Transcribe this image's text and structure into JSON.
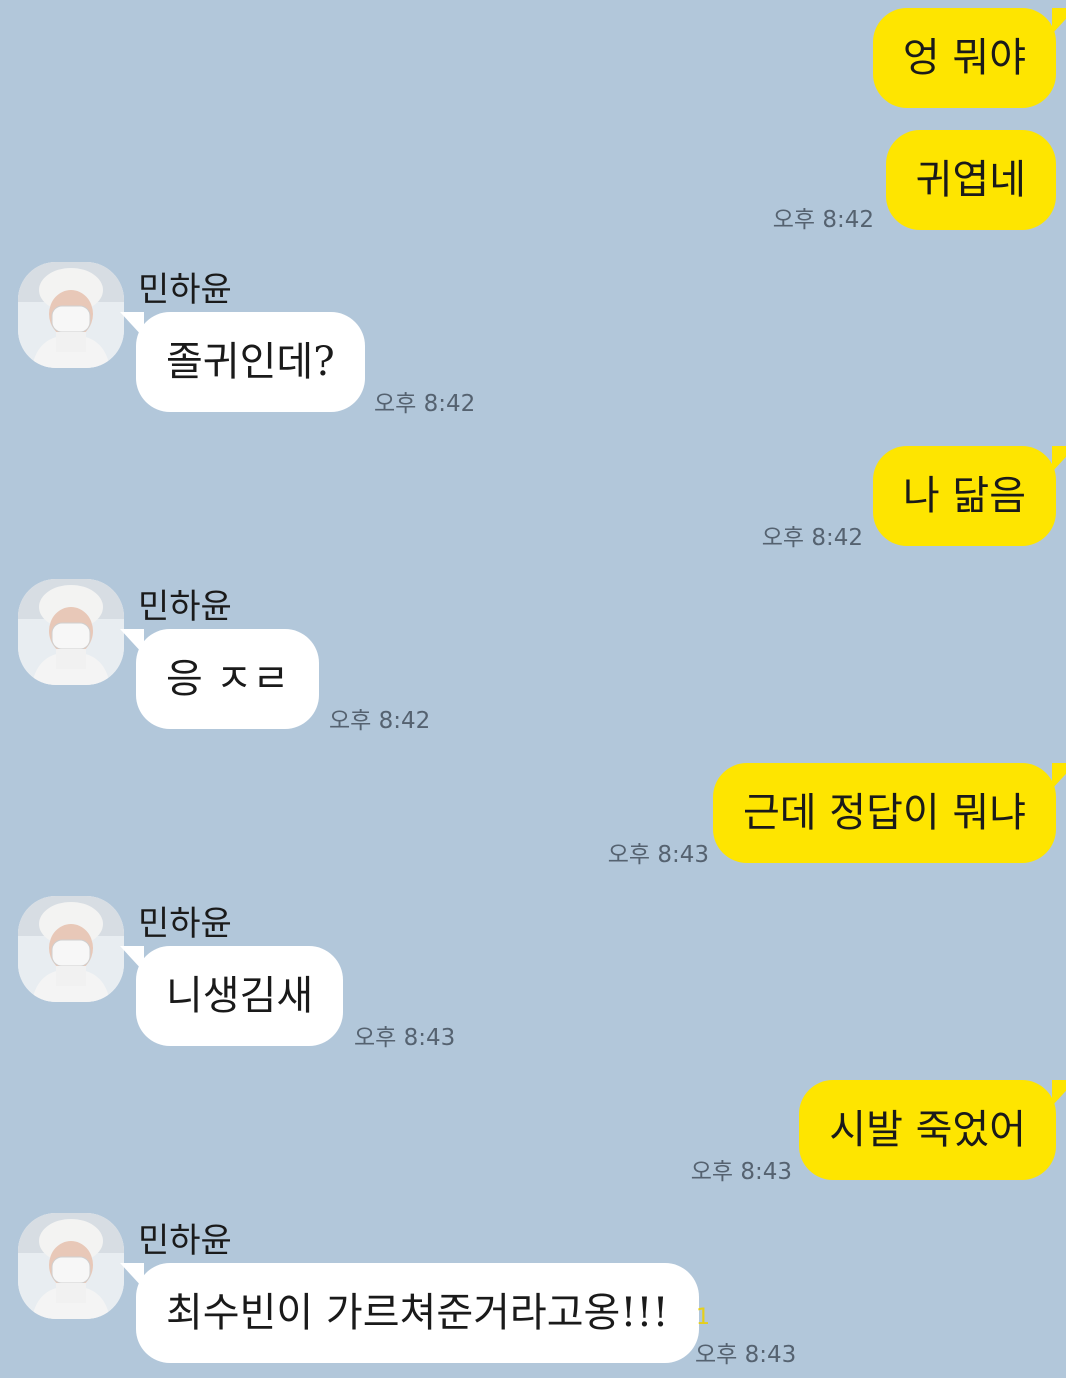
{
  "chat": {
    "sender_name": "민하윤",
    "messages": [
      {
        "from": "me",
        "text": "엉 뭐야",
        "time": ""
      },
      {
        "from": "me",
        "text": "귀엽네",
        "time": "오후 8:42"
      },
      {
        "from": "them",
        "text": "졸귀인데?",
        "time": "오후 8:42"
      },
      {
        "from": "me",
        "text": "나 닮음",
        "time": "오후 8:42"
      },
      {
        "from": "them",
        "text": "응 ㅈㄹ",
        "time": "오후 8:42"
      },
      {
        "from": "me",
        "text": "근데 정답이 뭐냐",
        "time": "오후 8:43"
      },
      {
        "from": "them",
        "text": "니생김새",
        "time": "오후 8:43"
      },
      {
        "from": "me",
        "text": "시발 죽었어",
        "time": "오후 8:43"
      },
      {
        "from": "them",
        "text": "최수빈이 가르쳐준거라고옹!!!",
        "time": "오후 8:43",
        "unread": "1"
      }
    ]
  },
  "colors": {
    "background": "#b2c7da",
    "my_bubble": "#fee500",
    "their_bubble": "#ffffff",
    "unread": "#e6cf1a"
  },
  "icons": {
    "avatar": "profile-avatar-icon"
  }
}
